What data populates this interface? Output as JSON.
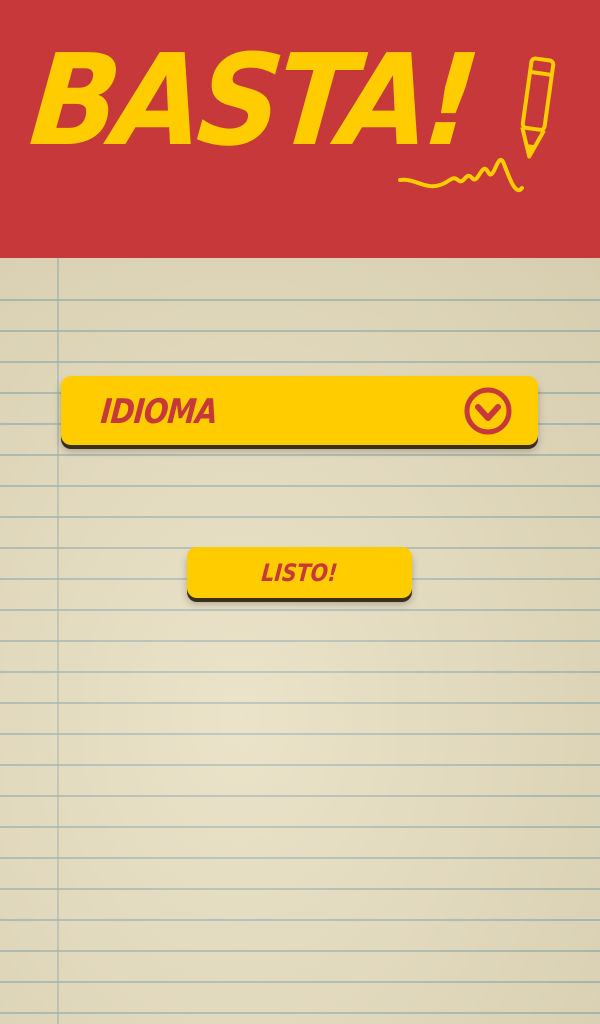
{
  "header": {
    "logo_text": "BASTA!",
    "colors": {
      "background": "#c7383b",
      "logo": "#ffcc00"
    }
  },
  "language_select": {
    "label": "IDIOMA",
    "icon": "chevron-down-icon"
  },
  "done_button": {
    "label": "LISTO!"
  },
  "colors": {
    "button": "#ffcc00",
    "button_text": "#c7383b",
    "paper": "#e4dcc0",
    "paper_lines": "#78a0aa"
  }
}
